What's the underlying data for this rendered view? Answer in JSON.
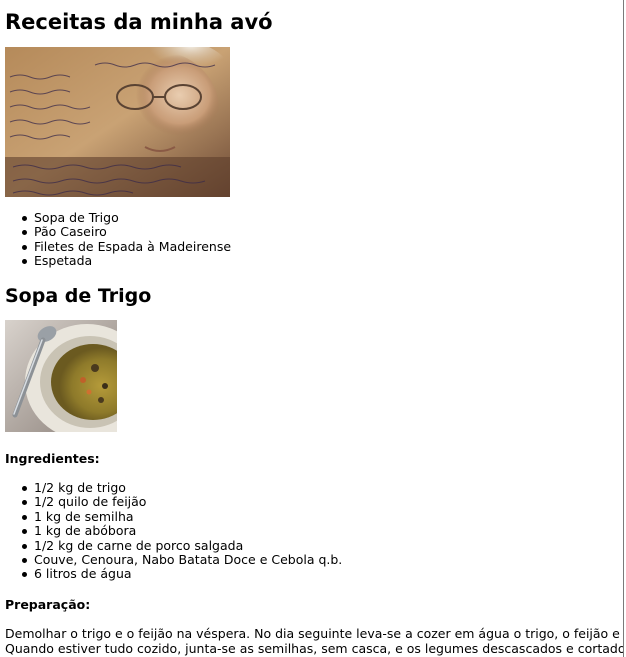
{
  "page": {
    "title": "Receitas da minha avó"
  },
  "toc": {
    "items": [
      "Sopa de Trigo",
      "Pão Caseiro",
      "Filetes de Espada à Madeirense",
      "Espetada"
    ]
  },
  "recipe": {
    "title": "Sopa de Trigo",
    "ingredients_label": "Ingredientes:",
    "ingredients": [
      "1/2 kg de trigo",
      "1/2 quilo de feijão",
      "1 kg de semilha",
      "1 kg de abóbora",
      "1/2 kg de carne de porco salgada",
      "Couve, Cenoura, Nabo Batata Doce e Cebola q.b.",
      "6 litros de água"
    ],
    "preparation_label": "Preparação:",
    "preparation_line1": "Demolhar o trigo e o feijão na véspera. No dia seguinte leva-se a cozer em água o trigo, o feijão e a carne de porco.",
    "preparation_line2": "Quando estiver tudo cozido, junta-se as semilhas, sem casca, e os legumes descascados e cortados em pedaços. Ant"
  },
  "images": {
    "header_photo": "grandmother-recipe-photo",
    "soup_photo": "wheat-soup-photo"
  }
}
